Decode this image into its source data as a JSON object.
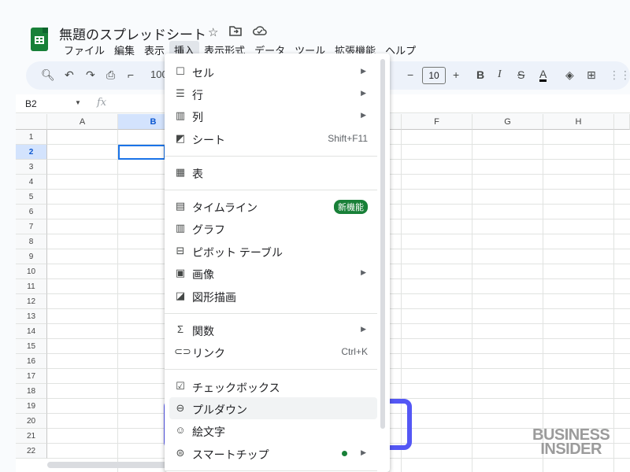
{
  "header": {
    "doc_title": "無題のスプレッドシート",
    "icons": [
      "star-icon",
      "move-folder-icon",
      "cloud-status-icon"
    ]
  },
  "menubar": [
    "ファイル",
    "編集",
    "表示",
    "挿入",
    "表示形式",
    "データ",
    "ツール",
    "拡張機能",
    "ヘルプ"
  ],
  "toolbar": {
    "zoom": "100",
    "font_size": "10"
  },
  "formula_bar": {
    "name_box": "B2",
    "fx": "fx"
  },
  "grid": {
    "columns": [
      "A",
      "B",
      "",
      "",
      "F",
      "G",
      "H"
    ],
    "rows": [
      "1",
      "2",
      "3",
      "4",
      "5",
      "6",
      "7",
      "8",
      "9",
      "10",
      "11",
      "12",
      "13",
      "14",
      "15",
      "16",
      "17",
      "18",
      "19",
      "20",
      "21",
      "22"
    ],
    "selected_cell": "B2"
  },
  "insert_menu": {
    "items": [
      {
        "label": "セル",
        "icon": "cell-icon",
        "arrow": true
      },
      {
        "label": "行",
        "icon": "row-icon",
        "arrow": true
      },
      {
        "label": "列",
        "icon": "column-icon",
        "arrow": true
      },
      {
        "label": "シート",
        "icon": "sheet-icon",
        "shortcut": "Shift+F11"
      },
      {
        "label": "表",
        "icon": "table-icon"
      },
      {
        "label": "タイムライン",
        "icon": "timeline-icon",
        "badge": "新機能"
      },
      {
        "label": "グラフ",
        "icon": "chart-icon"
      },
      {
        "label": "ピボット テーブル",
        "icon": "pivot-table-icon"
      },
      {
        "label": "画像",
        "icon": "image-icon",
        "arrow": true
      },
      {
        "label": "図形描画",
        "icon": "drawing-icon"
      },
      {
        "label": "関数",
        "icon": "sigma-icon",
        "arrow": true
      },
      {
        "label": "リンク",
        "icon": "link-icon",
        "shortcut": "Ctrl+K"
      },
      {
        "label": "チェックボックス",
        "icon": "checkbox-icon"
      },
      {
        "label": "プルダウン",
        "icon": "dropdown-icon"
      },
      {
        "label": "絵文字",
        "icon": "emoji-icon"
      },
      {
        "label": "スマートチップ",
        "icon": "smart-chip-icon",
        "arrow": true
      }
    ]
  },
  "watermark": {
    "line1": "BUSINESS",
    "line2": "INSIDER"
  },
  "colors": {
    "highlight": "#5457f5",
    "brand_green": "#188038",
    "selection": "#1a73e8"
  }
}
